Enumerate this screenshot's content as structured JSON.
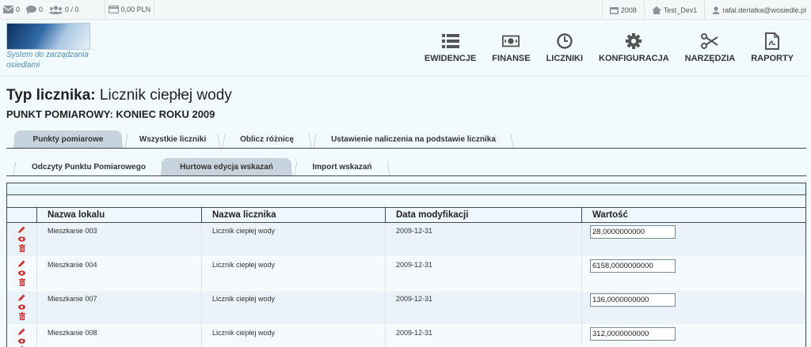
{
  "topbar": {
    "messages_count": "0",
    "comments_count": "0",
    "users_count": "0 / 0",
    "balance": "0,00 PLN",
    "year": "2008",
    "database": "Test_Dev1",
    "user_email": "rafal.derlatka@wosiedle.pl"
  },
  "header": {
    "logo_text": "System do zarządzania osiedlami",
    "nav": [
      {
        "label": "EWIDENCJE",
        "icon": "list-icon"
      },
      {
        "label": "FINANSE",
        "icon": "money-icon"
      },
      {
        "label": "LICZNIKI",
        "icon": "clock-icon"
      },
      {
        "label": "KONFIGURACJA",
        "icon": "gear-icon"
      },
      {
        "label": "NARZĘDZIA",
        "icon": "scissors-icon"
      },
      {
        "label": "RAPORTY",
        "icon": "pdf-icon"
      }
    ]
  },
  "page": {
    "title_label": "Typ licznika:",
    "title_value": "Licznik ciepłej wody",
    "subtitle": "PUNKT POMIAROWY: KONIEC ROKU 2009"
  },
  "tabs_main": [
    {
      "label": "Punkty pomiarowe",
      "active": true
    },
    {
      "label": "Wszystkie liczniki",
      "active": false
    },
    {
      "label": "Oblicz różnicę",
      "active": false
    },
    {
      "label": "Ustawienie naliczenia na podstawie licznika",
      "active": false
    }
  ],
  "tabs_sub": [
    {
      "label": "Odczyty Punktu Pomiarowego",
      "active": false
    },
    {
      "label": "Hurtowa edycja wskazań",
      "active": true
    },
    {
      "label": "Import wskazań",
      "active": false
    }
  ],
  "grid": {
    "columns": [
      "",
      "Nazwa lokalu",
      "Nazwa licznika",
      "Data modyfikacji",
      "Wartość"
    ],
    "rows": [
      {
        "lokal": "Mieszkanie 003",
        "licznik": "Licznik ciepłej wody",
        "data": "2009-12-31",
        "wartosc": "28,0000000000"
      },
      {
        "lokal": "Mieszkanie 004",
        "licznik": "Licznik ciepłej wody",
        "data": "2009-12-31",
        "wartosc": "6158,0000000000"
      },
      {
        "lokal": "Mieszkanie 007",
        "licznik": "Licznik ciepłej wody",
        "data": "2009-12-31",
        "wartosc": "136,0000000000"
      },
      {
        "lokal": "Mieszkanie 008",
        "licznik": "Licznik ciepłej wody",
        "data": "2009-12-31",
        "wartosc": "312,0000000000"
      }
    ]
  },
  "colors": {
    "accent_red": "#d9302c",
    "active_tab": "#c8d4dd"
  }
}
